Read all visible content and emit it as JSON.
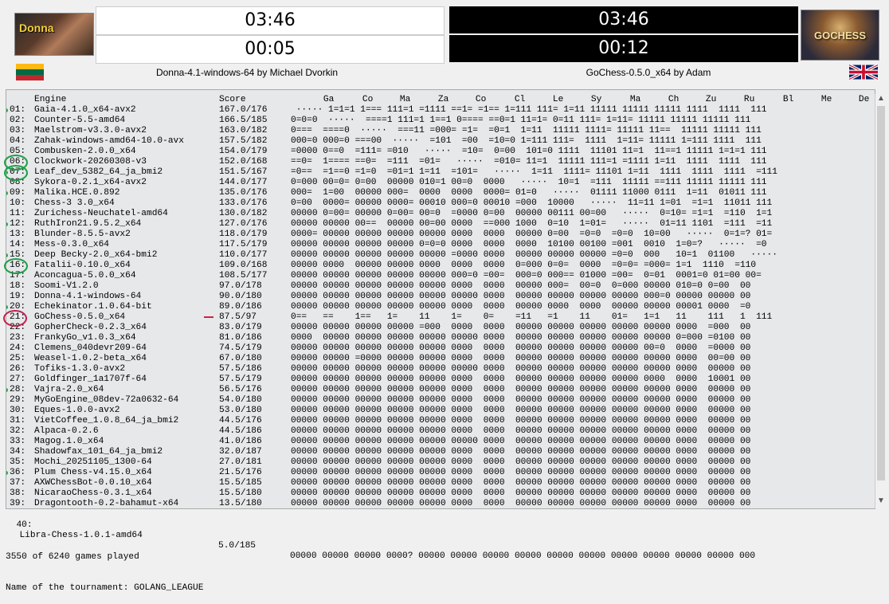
{
  "white": {
    "logo_text": "Donna",
    "clock_main": "03:46",
    "clock_move": "00:05",
    "engine": "Donna-4.1-windows-64 by Michael Dvorkin"
  },
  "black": {
    "logo_text": "GOCHESS",
    "clock_main": "03:46",
    "clock_move": "00:12",
    "engine": "GoChess-0.5.0_x64 by Adam"
  },
  "table": {
    "header": {
      "engine": "Engine",
      "score": "Score",
      "cols": [
        "Ga",
        "Co",
        "Ma",
        "Za",
        "Co",
        "Cl",
        "Le",
        "Sy",
        "Ma",
        "Ch",
        "Zu",
        "Ru",
        "Bl",
        "Me",
        "De"
      ]
    },
    "rows": [
      {
        "n": "01:",
        "name": "Gaia-4.1.0_x64-avx2",
        "score": "167.0/176",
        "cross": " ····· 1=1=1 1=== 111=1 =1111 ==1= =1== 1=111 111= 1=11 11111 11111 11111 1111  1111  111"
      },
      {
        "n": "02:",
        "name": "Counter-5.5-amd64",
        "score": "166.5/185",
        "cross": "0=0=0  ·····  ====1 111=1 1==1 0==== ==0=1 11=1= 0=11 111= 1=11= 11111 11111 11111 111"
      },
      {
        "n": "03:",
        "name": "Maelstrom-v3.3.0-avx2",
        "score": "163.0/182",
        "cross": "0===  ====0  ·····  ===11 =000= =1=  =0=1  1=11  11111 1111= 11111 11==  11111 11111 111"
      },
      {
        "n": "04:",
        "name": "Zahak-windows-amd64-10.0-avx",
        "score": "157.5/182",
        "cross": "000=0 000=0 ===00  ·····  =101  =00  =10=0 1=111 111=  1111  1=11= 11111 1=111 1111  111"
      },
      {
        "n": "05:",
        "name": "Combusken-2.0.0_x64",
        "score": "154.0/179",
        "cross": "=0000 0==0  =111= =010   ·····  =10=  0=00  101=0 1111  11101 11=1  11==1 11111 1=1=1 111"
      },
      {
        "n": "06:",
        "name": "Clockwork-20260308-v3",
        "score": "152.0/168",
        "cross": "==0=  1==== ==0=  =111  =01=   ·····  =010= 11=1  11111 111=1 =1111 1=11  1111  1111  111"
      },
      {
        "n": "07:",
        "name": "Leaf_dev_5382_64_ja_bmi2",
        "score": "151.5/167",
        "cross": "=0==  =1==0 =1=0  =01=1 1=11  =101=   ·····  1=11  1111= 11101 1=11  1111  1111  1111  =111"
      },
      {
        "n": "08:",
        "name": "Sykora-0.2.1_x64-avx2",
        "score": "144.0/177",
        "cross": "0=000 00=0= 0=00  00000 010=1 00=0  0000   ·····  10=1  =111  11111 ==111 11111 11111 111"
      },
      {
        "n": "09:",
        "name": "Malika.HCE.0.892",
        "score": "135.0/176",
        "cross": "000=  1=00  00000 000=  0000  0000  0000= 01=0   ·····  01111 11000 0111  1=11  01011 111"
      },
      {
        "n": "10:",
        "name": "Chess-3 3.0_x64",
        "score": "133.0/176",
        "cross": "0=00  0000= 00000 0000= 00010 000=0 00010 =000  10000   ·····  11=11 1=01  =1=1  11011 111"
      },
      {
        "n": "11:",
        "name": "Zurichess-Neuchatel-amd64",
        "score": "130.0/182",
        "cross": "00000 0=00= 00000 0=00= 00=0  =0000 0=00  00000 00111 00=00   ·····  0=10= =1=1  =110  1=1"
      },
      {
        "n": "12:",
        "name": "RuthIron21.9.5.2_x64",
        "score": "127.0/176",
        "cross": "00000 00000 00==  00000 00=00 0000  ==000 1000  0=10  1=01=   ·····  01=11 1101  =111  =11"
      },
      {
        "n": "13:",
        "name": "Blunder-8.5.5-avx2",
        "score": "118.0/179",
        "cross": "0000= 00000 00000 00000 00000 0000  0000  00000 0=00  =0=0  =0=0  10=00   ·····  0=1=? 01="
      },
      {
        "n": "14:",
        "name": "Mess-0.3.0_x64",
        "score": "117.5/179",
        "cross": "00000 00000 00000 00000 0=0=0 0000  0000  0000  10100 00100 =001  0010  1=0=?   ·····  =0"
      },
      {
        "n": "15:",
        "name": "Deep Becky-2.0_x64-bmi2",
        "score": "110.0/177",
        "cross": "00000 00000 00000 00000 00000 =0000 0000  00000 00000 00000 =0=0  000   10=1  01100   ·····"
      },
      {
        "n": "16:",
        "name": "Fatalii-0.10.0_x64",
        "score": "109.0/168",
        "cross": "00000 0000  00000 00000 0000  0000  0000  0=000 0=0=  0000  =0=0= =000= 1=1  1110  =110"
      },
      {
        "n": "17:",
        "name": "Aconcagua-5.0.0_x64",
        "score": "108.5/177",
        "cross": "00000 00000 00000 00000 00000 000=0 =00=  000=0 000== 01000 =00=  0=01  0001=0 01=00 00="
      },
      {
        "n": "18:",
        "name": "Soomi-V1.2.0",
        "score": "97.0/178",
        "cross": "00000 00000 00000 00000 00000 0000  0000  00000 000=  00=0  0=000 00000 010=0 0=00  00"
      },
      {
        "n": "19:",
        "name": "Donna-4.1-windows-64",
        "score": "90.0/180",
        "cross": "00000 00000 00000 00000 00000 00000 0000  00000 00000 00000 00000 000=0 00000 00000 00"
      },
      {
        "n": "20:",
        "name": "Echekinator.1.0.64-bit",
        "score": "89.0/186",
        "cross": "00000 00000 00000 00000 00000 0000  0000  00000 0000  0000  00000 00000 00001 0000  =0"
      },
      {
        "n": "21:",
        "name": "GoChess-0.5.0_x64",
        "score": "87.5/97",
        "cross": "0==   ==    1==   1=    11    1=    0=    =11   =1    11    01=   1=1   11    111   1  111"
      },
      {
        "n": "22:",
        "name": "GopherCheck-0.2.3_x64",
        "score": "83.0/179",
        "cross": "00000 00000 00000 00000 =000  0000  0000  00000 00000 00000 00000 00000 0000  =000  00"
      },
      {
        "n": "23:",
        "name": "FrankyGo_v1.0.3_x64",
        "score": "81.0/186",
        "cross": "0000  00000 00000 00000 00000 00000 0000  00000 00000 00000 00000 00000 0=000 =0100 00"
      },
      {
        "n": "24:",
        "name": "Clemens_040devr209-64",
        "score": "74.5/179",
        "cross": "00000 00000 00000 00000 00000 0000  0000  00000 00000 00000 00000 00=0  0000  =0000 00"
      },
      {
        "n": "25:",
        "name": "Weasel-1.0.2-beta_x64",
        "score": "67.0/180",
        "cross": "00000 00000 =0000 00000 00000 0000  0000  00000 00000 00000 00000 00000 0000  00=00 00"
      },
      {
        "n": "26:",
        "name": "Tofiks-1.3.0-avx2",
        "score": "57.5/186",
        "cross": "00000 00000 00000 00000 00000 00000 0000  00000 00000 00000 00000 00000 0000  00000 00"
      },
      {
        "n": "27:",
        "name": "Goldfinger_1a1707f-64",
        "score": "57.5/179",
        "cross": "00000 00000 00000 00000 00000 0000  0000  00000 00000 00000 00000 0000  0000  10001 00"
      },
      {
        "n": "28:",
        "name": "Vajra-2.0_x64",
        "score": "56.5/176",
        "cross": "00000 00000 00000 00000 00000 0000  0000  00000 00000 00000 00000 00000 0000  00000 00"
      },
      {
        "n": "29:",
        "name": "MyGoEngine_08dev-72a0632-64",
        "score": "54.0/180",
        "cross": "00000 00000 00000 00000 00000 0000  0000  00000 00000 00000 00000 00000 0000  00000 00"
      },
      {
        "n": "30:",
        "name": "Eques-1.0.0-avx2",
        "score": "53.0/180",
        "cross": "00000 00000 00000 00000 00000 0000  0000  00000 00000 00000 00000 00000 0000  00000 00"
      },
      {
        "n": "31:",
        "name": "VietCoffee_1.0.8_64_ja_bmi2",
        "score": "44.5/176",
        "cross": "00000 00000 00000 00000 00000 0000  0000  00000 00000 00000 00000 00000 0000  00000 00"
      },
      {
        "n": "32:",
        "name": "Alpaca-0.2.6",
        "score": "44.5/186",
        "cross": "00000 00000 00000 00000 00000 0000  0000  00000 00000 00000 00000 00000 0000  00000 00"
      },
      {
        "n": "33:",
        "name": "Magog.1.0_x64",
        "score": "41.0/186",
        "cross": "00000 00000 00000 00000 00000 00000 0000  00000 00000 00000 00000 00000 0000  00000 00"
      },
      {
        "n": "34:",
        "name": "Shadowfax_101_64_ja_bmi2",
        "score": "32.0/187",
        "cross": "00000 00000 00000 00000 00000 0000  0000  00000 00000 00000 00000 00000 0000  00000 00"
      },
      {
        "n": "35:",
        "name": "Mochi_20251105_1300-64",
        "score": "27.0/181",
        "cross": "00000 00000 00000 00000 00000 0000  0000  00000 00000 00000 00000 00000 0000  00000 00"
      },
      {
        "n": "36:",
        "name": "Plum Chess-v4.15.0_x64",
        "score": "21.5/176",
        "cross": "00000 00000 00000 00000 00000 0000  0000  00000 00000 00000 00000 00000 0000  00000 00"
      },
      {
        "n": "37:",
        "name": "AXWChessBot-0.0.10_x64",
        "score": "15.5/185",
        "cross": "00000 00000 00000 00000 00000 0000  0000  00000 00000 00000 00000 00000 0000  00000 00"
      },
      {
        "n": "38:",
        "name": "NicaraoChess-0.3.1_x64",
        "score": "15.5/180",
        "cross": "00000 00000 00000 00000 00000 0000  0000  00000 00000 00000 00000 00000 0000  00000 00"
      },
      {
        "n": "39:",
        "name": "Dragontooth-0.2-bahamut-x64",
        "score": "13.5/180",
        "cross": "00000 00000 00000 00000 00000 0000  0000  00000 00000 00000 00000 00000 0000  00000 00"
      }
    ]
  },
  "last_row": {
    "n": "40:",
    "name": "Libra-Chess-1.0.1-amd64",
    "score": "5.0/185",
    "cross": "00000 00000 00000 0000? 00000 00000 00000 00000 00000 00000 00000 00000 00000 00000 000"
  },
  "footer": {
    "games": "3550 of 6240 games played",
    "tournament": "Name of the tournament: GOLANG_LEAGUE"
  },
  "colors": {
    "highlight_green": "#1e9e47",
    "highlight_red": "#c41e4a",
    "table_bg": "#e6e8ea"
  }
}
